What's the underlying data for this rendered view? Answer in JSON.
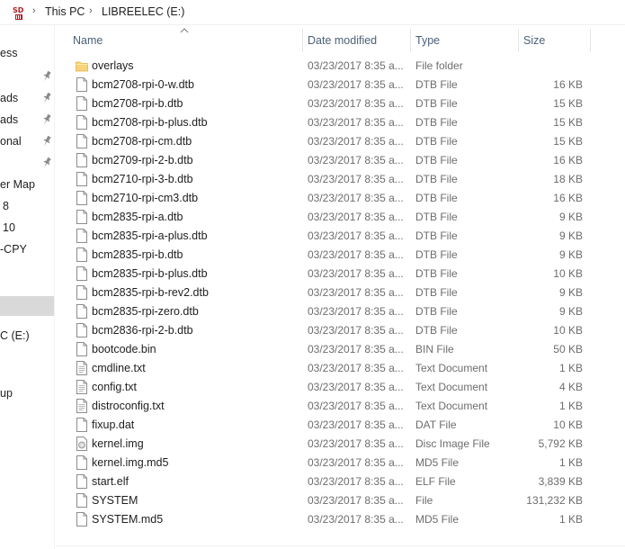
{
  "address": {
    "crumbs": [
      "This PC",
      "LIBREELEC (E:)"
    ]
  },
  "nav": {
    "items": [
      "ess",
      "ads",
      "ads",
      "onal",
      "er Map",
      "8",
      "10",
      "-CPY",
      "C (E:)",
      "up"
    ]
  },
  "columns": {
    "name": "Name",
    "date": "Date modified",
    "type": "Type",
    "size": "Size"
  },
  "files": [
    {
      "icon": "folder",
      "name": "overlays",
      "date": "03/23/2017 8:35 a...",
      "type": "File folder",
      "size": ""
    },
    {
      "icon": "file",
      "name": "bcm2708-rpi-0-w.dtb",
      "date": "03/23/2017 8:35 a...",
      "type": "DTB File",
      "size": "16 KB"
    },
    {
      "icon": "file",
      "name": "bcm2708-rpi-b.dtb",
      "date": "03/23/2017 8:35 a...",
      "type": "DTB File",
      "size": "15 KB"
    },
    {
      "icon": "file",
      "name": "bcm2708-rpi-b-plus.dtb",
      "date": "03/23/2017 8:35 a...",
      "type": "DTB File",
      "size": "15 KB"
    },
    {
      "icon": "file",
      "name": "bcm2708-rpi-cm.dtb",
      "date": "03/23/2017 8:35 a...",
      "type": "DTB File",
      "size": "15 KB"
    },
    {
      "icon": "file",
      "name": "bcm2709-rpi-2-b.dtb",
      "date": "03/23/2017 8:35 a...",
      "type": "DTB File",
      "size": "16 KB"
    },
    {
      "icon": "file",
      "name": "bcm2710-rpi-3-b.dtb",
      "date": "03/23/2017 8:35 a...",
      "type": "DTB File",
      "size": "18 KB"
    },
    {
      "icon": "file",
      "name": "bcm2710-rpi-cm3.dtb",
      "date": "03/23/2017 8:35 a...",
      "type": "DTB File",
      "size": "16 KB"
    },
    {
      "icon": "file",
      "name": "bcm2835-rpi-a.dtb",
      "date": "03/23/2017 8:35 a...",
      "type": "DTB File",
      "size": "9 KB"
    },
    {
      "icon": "file",
      "name": "bcm2835-rpi-a-plus.dtb",
      "date": "03/23/2017 8:35 a...",
      "type": "DTB File",
      "size": "9 KB"
    },
    {
      "icon": "file",
      "name": "bcm2835-rpi-b.dtb",
      "date": "03/23/2017 8:35 a...",
      "type": "DTB File",
      "size": "9 KB"
    },
    {
      "icon": "file",
      "name": "bcm2835-rpi-b-plus.dtb",
      "date": "03/23/2017 8:35 a...",
      "type": "DTB File",
      "size": "10 KB"
    },
    {
      "icon": "file",
      "name": "bcm2835-rpi-b-rev2.dtb",
      "date": "03/23/2017 8:35 a...",
      "type": "DTB File",
      "size": "9 KB"
    },
    {
      "icon": "file",
      "name": "bcm2835-rpi-zero.dtb",
      "date": "03/23/2017 8:35 a...",
      "type": "DTB File",
      "size": "9 KB"
    },
    {
      "icon": "file",
      "name": "bcm2836-rpi-2-b.dtb",
      "date": "03/23/2017 8:35 a...",
      "type": "DTB File",
      "size": "10 KB"
    },
    {
      "icon": "file",
      "name": "bootcode.bin",
      "date": "03/23/2017 8:35 a...",
      "type": "BIN File",
      "size": "50 KB"
    },
    {
      "icon": "text",
      "name": "cmdline.txt",
      "date": "03/23/2017 8:35 a...",
      "type": "Text Document",
      "size": "1 KB"
    },
    {
      "icon": "text",
      "name": "config.txt",
      "date": "03/23/2017 8:35 a...",
      "type": "Text Document",
      "size": "4 KB"
    },
    {
      "icon": "text",
      "name": "distroconfig.txt",
      "date": "03/23/2017 8:35 a...",
      "type": "Text Document",
      "size": "1 KB"
    },
    {
      "icon": "file",
      "name": "fixup.dat",
      "date": "03/23/2017 8:35 a...",
      "type": "DAT File",
      "size": "10 KB"
    },
    {
      "icon": "disc",
      "name": "kernel.img",
      "date": "03/23/2017 8:35 a...",
      "type": "Disc Image File",
      "size": "5,792 KB"
    },
    {
      "icon": "file",
      "name": "kernel.img.md5",
      "date": "03/23/2017 8:35 a...",
      "type": "MD5 File",
      "size": "1 KB"
    },
    {
      "icon": "file",
      "name": "start.elf",
      "date": "03/23/2017 8:35 a...",
      "type": "ELF File",
      "size": "3,839 KB"
    },
    {
      "icon": "file",
      "name": "SYSTEM",
      "date": "03/23/2017 8:35 a...",
      "type": "File",
      "size": "131,232 KB"
    },
    {
      "icon": "file",
      "name": "SYSTEM.md5",
      "date": "03/23/2017 8:35 a...",
      "type": "MD5 File",
      "size": "1 KB"
    }
  ]
}
